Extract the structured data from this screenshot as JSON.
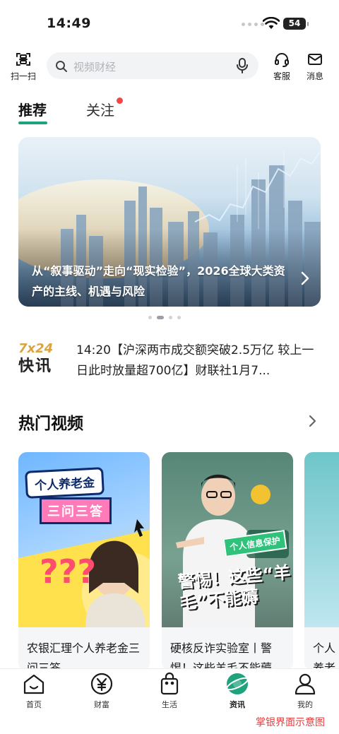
{
  "status_bar": {
    "time": "14:49",
    "battery": "54"
  },
  "top_bar": {
    "scan_label": "扫一扫",
    "search_placeholder": "视频财经",
    "service_label": "客服",
    "message_label": "消息"
  },
  "tabs": [
    {
      "label": "推荐",
      "active": true
    },
    {
      "label": "关注",
      "has_dot": true
    }
  ],
  "banner": {
    "text": "从“叙事驱动”走向“现实检验”，2026全球大类资产的主线、机遇与风险",
    "page_index": 2,
    "page_count": 4
  },
  "flash_news": {
    "logo_top": "7x24",
    "logo_bottom": "快讯",
    "text": "14:20【沪深两市成交额突破2.5万亿 较上一日此时放量超700亿】财联社1月7..."
  },
  "hot_videos": {
    "title": "热门视频",
    "items": [
      {
        "title": "农银汇理个人养老金三问三答",
        "tag1": "个人养老金",
        "tag2": "三问三答"
      },
      {
        "title": "硬核反诈实验室丨警惕！这些羊毛不能薅",
        "banner_tag": "个人信息保护",
        "headline": "警惕！这些“羊毛”不能薅"
      },
      {
        "title": "个人养老金一看就懂"
      }
    ]
  },
  "bottom_nav": [
    {
      "label": "首页"
    },
    {
      "label": "财富"
    },
    {
      "label": "生活"
    },
    {
      "label": "资讯",
      "active": true
    },
    {
      "label": "我的"
    }
  ],
  "watermark": "掌银界面示意图",
  "colors": {
    "accent": "#1fa37c",
    "badge": "#f04848",
    "watermark": "#e53b3b"
  }
}
